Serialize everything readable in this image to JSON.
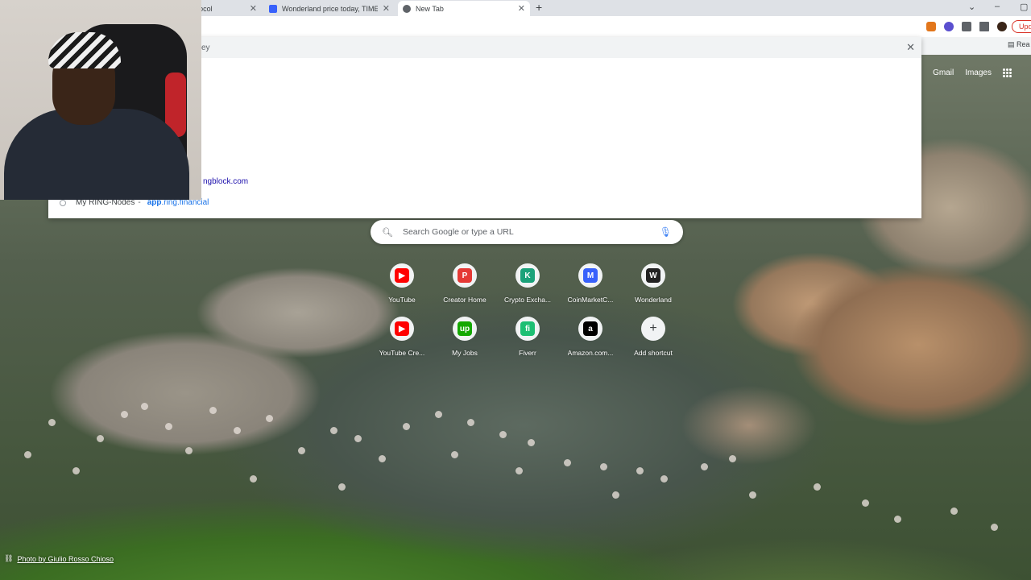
{
  "tabs": [
    {
      "title": "@JadeProtocol",
      "favicon_color": "#1d9bf0",
      "active": false
    },
    {
      "title": "Wonderland price today, TIME to",
      "favicon_color": "#3861fb",
      "active": false
    },
    {
      "title": "New Tab",
      "favicon_color": "#5f6368",
      "active": true
    }
  ],
  "toolbar": {
    "update_label": "Upd",
    "reading_list_label": "Rea"
  },
  "omnibox_dropdown": {
    "partial_top_text": "ey",
    "suggestion_1": "ngblock.com",
    "suggestion_2_title": "My RING-Nodes",
    "suggestion_2_sep": "-",
    "suggestion_2_url_bold": "app",
    "suggestion_2_url_rest": ".ring.financial"
  },
  "ntp": {
    "gmail": "Gmail",
    "images": "Images",
    "search_placeholder": "Search Google or type a URL",
    "shortcuts": [
      {
        "label": "YouTube",
        "icon": "youtube-icon",
        "color": "#ff0000",
        "glyph": "▶"
      },
      {
        "label": "Creator Home",
        "icon": "creator-home-icon",
        "color": "#e53935",
        "glyph": "P"
      },
      {
        "label": "Crypto Excha...",
        "icon": "crypto-exchange-icon",
        "color": "#1ba27a",
        "glyph": "K"
      },
      {
        "label": "CoinMarketC...",
        "icon": "coinmarketcap-icon",
        "color": "#3861fb",
        "glyph": "M"
      },
      {
        "label": "Wonderland",
        "icon": "wonderland-icon",
        "color": "#222222",
        "glyph": "W"
      },
      {
        "label": "YouTube Cre...",
        "icon": "youtube-studio-icon",
        "color": "#ff0000",
        "glyph": "▶"
      },
      {
        "label": "My Jobs",
        "icon": "upwork-icon",
        "color": "#14a800",
        "glyph": "up"
      },
      {
        "label": "Fiverr",
        "icon": "fiverr-icon",
        "color": "#1dbf73",
        "glyph": "fi"
      },
      {
        "label": "Amazon.com...",
        "icon": "amazon-icon",
        "color": "#000000",
        "glyph": "a"
      },
      {
        "label": "Add shortcut",
        "icon": "plus-icon",
        "color": "#3c4043",
        "glyph": "+"
      }
    ],
    "photo_credit": "Photo by Giulio Rosso Chioso"
  }
}
